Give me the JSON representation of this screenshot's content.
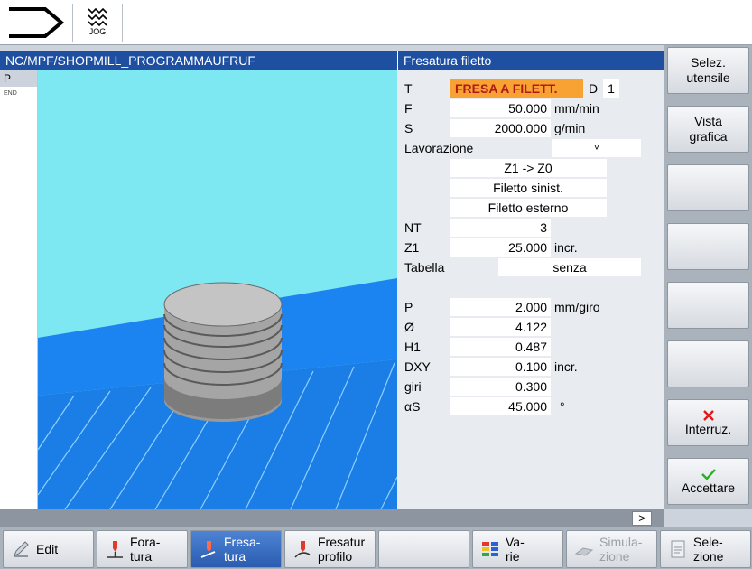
{
  "topbar": {
    "jog_label": "JOG"
  },
  "path": "NC/MPF/SHOPMILL_PROGRAMMAUFRUF",
  "title": "Fresatura filetto",
  "program_list": {
    "current": "P",
    "end": "END"
  },
  "form": {
    "t_label": "T",
    "t_value": "FRESA A FILETT.",
    "d_label": "D",
    "d_value": "1",
    "f_label": "F",
    "f_value": "50.000",
    "f_unit": "mm/min",
    "s_label": "S",
    "s_value": "2000.000",
    "s_unit": "g/min",
    "lav_label": "Lavorazione",
    "lav_value": "˅",
    "dir_value": "Z1 -> Z0",
    "thread_dir": "Filetto sinist.",
    "thread_type": "Filetto esterno",
    "nt_label": "NT",
    "nt_value": "3",
    "z1_label": "Z1",
    "z1_value": "25.000",
    "z1_unit": "incr.",
    "tab_label": "Tabella",
    "tab_value": "senza",
    "p_label": "P",
    "p_value": "2.000",
    "p_unit": "mm/giro",
    "dia_label": "Ø",
    "dia_value": "4.122",
    "h1_label": "H1",
    "h1_value": "0.487",
    "dxy_label": "DXY",
    "dxy_value": "0.100",
    "dxy_unit": "incr.",
    "giri_label": "giri",
    "giri_value": "0.300",
    "as_label": "αS",
    "as_value": "45.000",
    "as_unit": "°"
  },
  "softkeys_right": {
    "select_tool_1": "Selez.",
    "select_tool_2": "utensile",
    "graphic_view_1": "Vista",
    "graphic_view_2": "grafica",
    "abort": "Interruz.",
    "accept": "Accettare"
  },
  "status": {
    "more": ">"
  },
  "softkeys_bottom": {
    "edit": "Edit",
    "drilling_1": "Fora-",
    "drilling_2": "tura",
    "milling_1": "Fresa-",
    "milling_2": "tura",
    "contour_1": "Fresatur",
    "contour_2": "profilo",
    "various_1": "Va-",
    "various_2": "rie",
    "simulation_1": "Simula-",
    "simulation_2": "zione",
    "selection_1": "Sele-",
    "selection_2": "zione"
  },
  "colors": {
    "titlebar": "#1e4fa0",
    "highlight": "#f7a233",
    "viewport": "#7ee8f2",
    "floor": "#1c84f0"
  }
}
